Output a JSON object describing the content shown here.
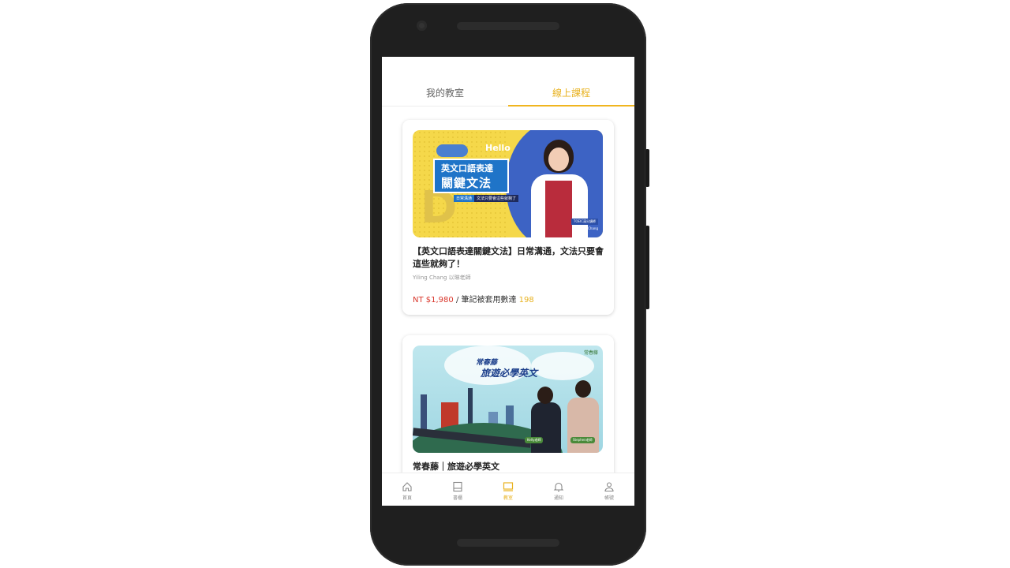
{
  "tabs": {
    "my_classroom": "我的教室",
    "online_courses": "線上課程"
  },
  "courses": [
    {
      "title": "【英文口語表達關鍵文法】日常溝通，文法只要會這些就夠了！",
      "teacher": "Yiling Chang 以琳老師",
      "price": "NT $1,980",
      "meta_label": " / 筆記被套用數達 ",
      "count": "198",
      "thumb": {
        "hello": "Hello",
        "headline_1": "英文口語表達",
        "headline_2": "關鍵文法",
        "tag_1": "日常溝通",
        "tag_2": "文法只要會這些就夠了",
        "badge_1": "TOEIC滿分講師",
        "badge_2": "Yiling Chang"
      }
    },
    {
      "title": "常春藤｜旅遊必學英文",
      "thumb": {
        "title_1": "常春藤",
        "title_2": "旅遊必學英文",
        "logo": "常春藤",
        "name_1": "Kelly老師",
        "name_2": "Stephen老師"
      }
    }
  ],
  "bottom_nav": [
    {
      "label": "首頁",
      "icon": "home-icon"
    },
    {
      "label": "書櫃",
      "icon": "bookshelf-icon"
    },
    {
      "label": "教室",
      "icon": "classroom-icon"
    },
    {
      "label": "通知",
      "icon": "bell-icon"
    },
    {
      "label": "帳號",
      "icon": "account-icon"
    }
  ],
  "colors": {
    "accent": "#f0b51f",
    "price": "#d9362b"
  }
}
